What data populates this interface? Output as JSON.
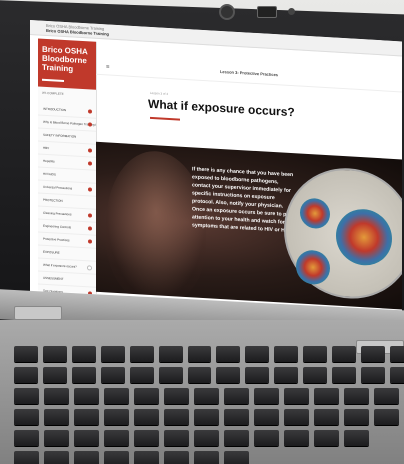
{
  "course": {
    "top_small": "Brico OSHA Bloodborne Training",
    "top_title": "Brico OSHA Bloodborne Training",
    "brand_title": "Brico OSHA Bloodborne Training",
    "brand_sub": "0% COMPLETE"
  },
  "sidebar": {
    "items": [
      {
        "label": "INTRODUCTION",
        "status": "done"
      },
      {
        "label": "Why is Blood Borne Pathogen Training Important?",
        "status": "done"
      },
      {
        "label": "SAFETY INFORMATION",
        "status": "none"
      },
      {
        "label": "HBV",
        "status": "done"
      },
      {
        "label": "Hepatitis",
        "status": "done"
      },
      {
        "label": "HIV/AIDS",
        "status": "none"
      },
      {
        "label": "Universal Precautions",
        "status": "done"
      },
      {
        "label": "PROTECTION",
        "status": "none"
      },
      {
        "label": "Cleaning Precautions",
        "status": "done"
      },
      {
        "label": "Engineering Controls",
        "status": "done"
      },
      {
        "label": "Protective Practices",
        "status": "done"
      },
      {
        "label": "EXPOSURE",
        "status": "none"
      },
      {
        "label": "What if exposure occurs?",
        "status": "empty"
      },
      {
        "label": "ASSESSMENT",
        "status": "none"
      },
      {
        "label": "Test Questions",
        "status": "done"
      }
    ]
  },
  "header": {
    "menu_glyph": "≡",
    "page_heading": "Lesson 3: Protective Practices"
  },
  "lesson": {
    "label": "Lesson 3 of 4",
    "title": "What if exposure occurs?"
  },
  "hero": {
    "text": "If there is any chance that you have been exposed to bloodborne pathogens, contact your supervisor immediately for specific instructions on exposure protocol. Also, notify your physician. Once an exposure occurs be sure to pay attention to your health and watch for any symptoms that are related to HIV or HBV."
  },
  "colors": {
    "accent": "#c0392b"
  }
}
